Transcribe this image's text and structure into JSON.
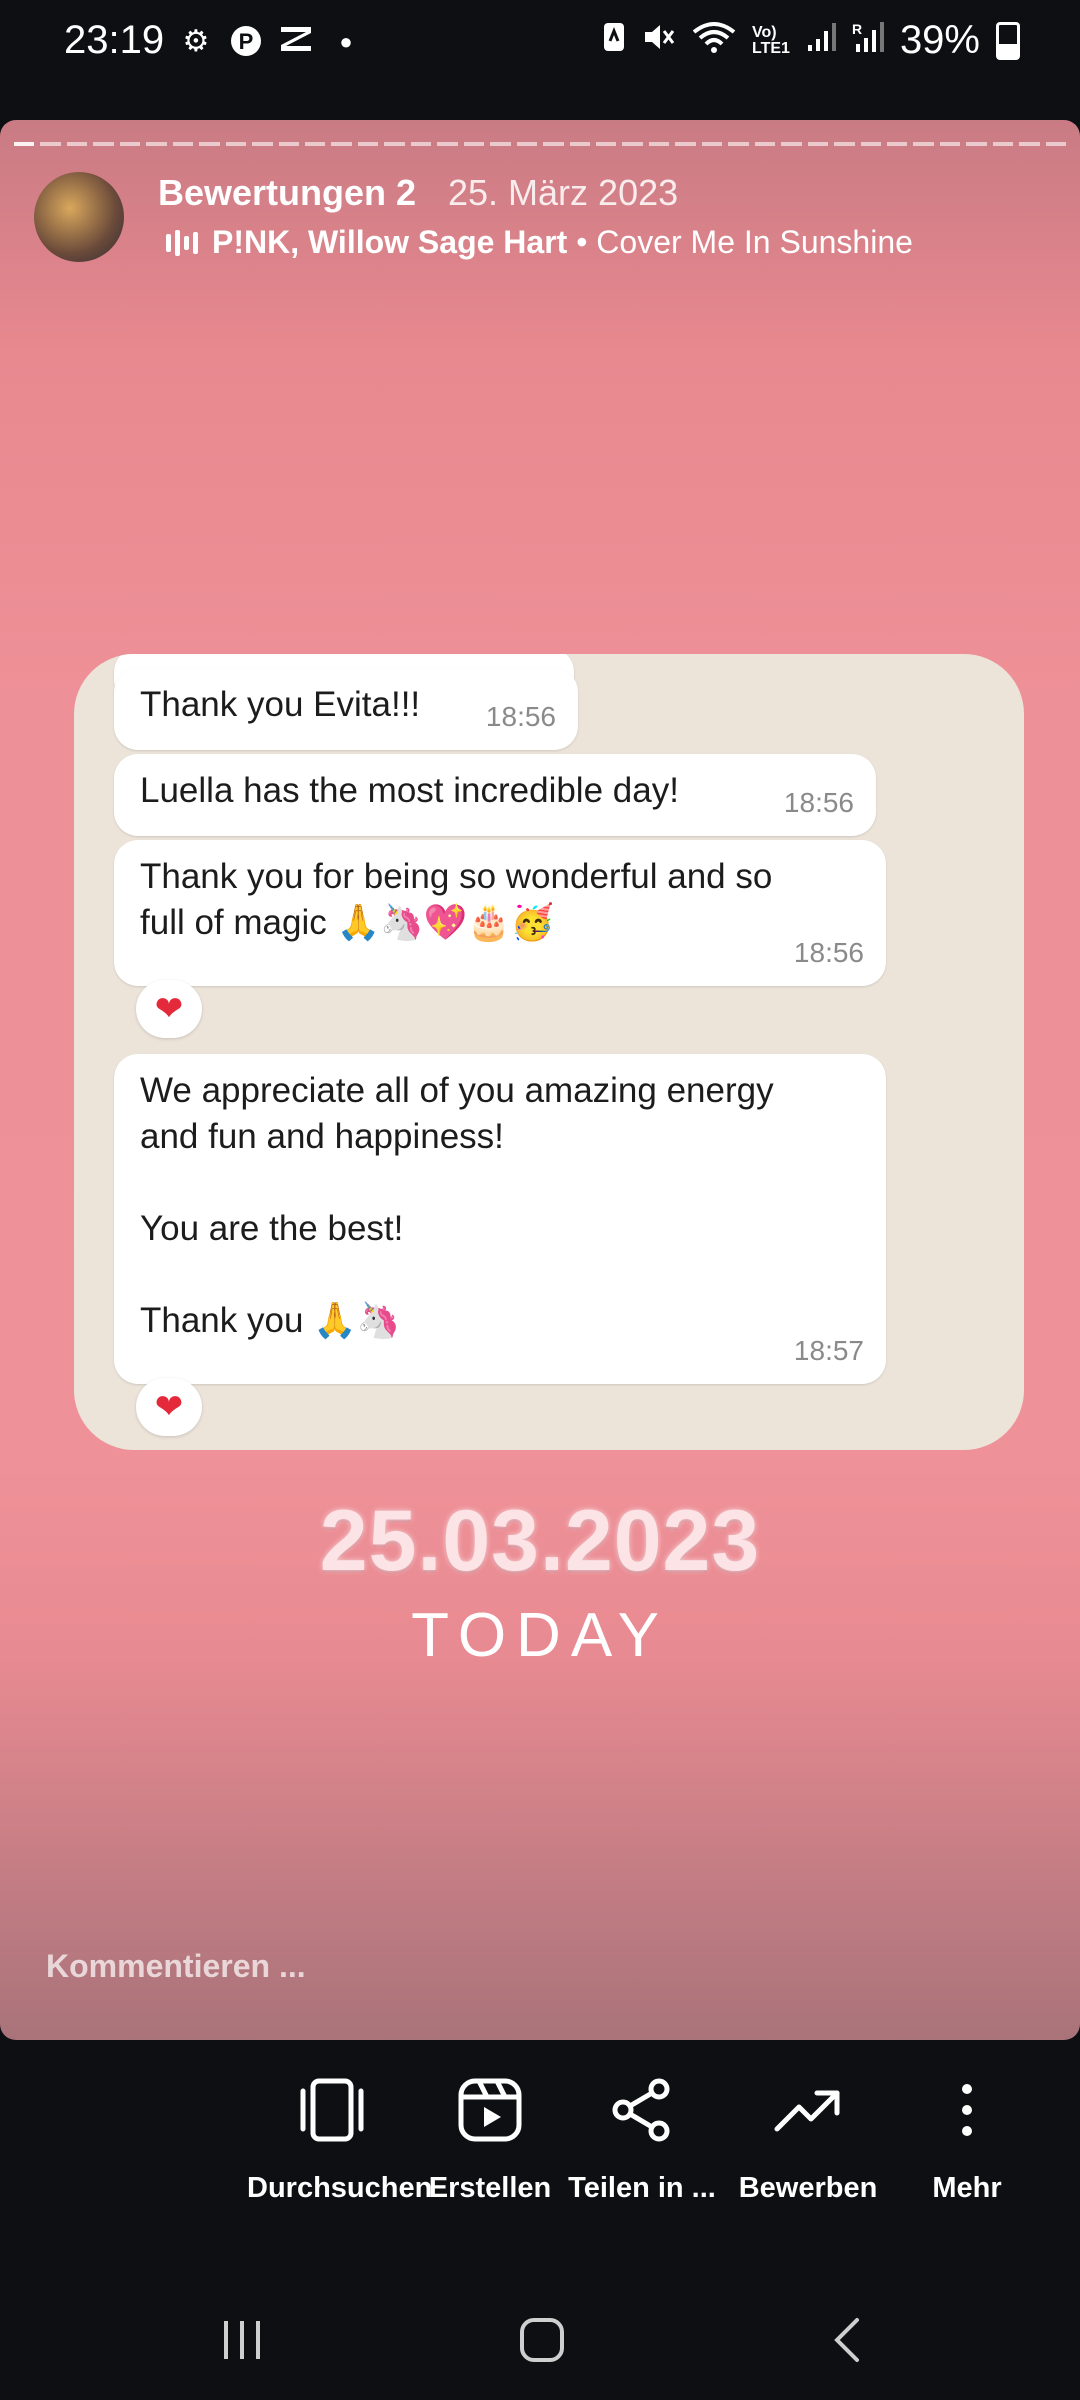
{
  "status_bar": {
    "time": "23:19",
    "left_icons": [
      "gear-icon",
      "pinterest-icon",
      "capcut-icon",
      "dot-icon"
    ],
    "right_icons": [
      "nfc-icon",
      "mute-icon",
      "wifi-icon",
      "volte-icon",
      "signal-icon",
      "signal-roaming-icon"
    ],
    "battery": "39%"
  },
  "story": {
    "account": "Bewertungen 2",
    "date": "25. März 2023",
    "music_artists": "P!NK, Willow Sage Hart",
    "music_song": "• Cover Me In Sunshine",
    "messages": [
      {
        "text": "Thank you Evita!!!",
        "time": "18:56"
      },
      {
        "text": "Luella has the most incredible day!",
        "time": "18:56"
      },
      {
        "text": "Thank you for being so wonderful and so\nfull of magic 🙏🦄💖🎂🥳",
        "time": "18:56"
      },
      {
        "text": "We appreciate all of you amazing energy\nand fun and happiness!\n\nYou are the best!\n\nThank you 🙏🦄",
        "time": "18:57"
      }
    ],
    "reaction": "❤",
    "big_date": "25.03.2023",
    "today": "TODAY",
    "comment_placeholder": "Kommentieren ..."
  },
  "actions": [
    {
      "label": "Durchsuchen",
      "icon": "browse-icon"
    },
    {
      "label": "Erstellen",
      "icon": "reels-create-icon"
    },
    {
      "label": "Teilen in ...",
      "icon": "share-icon"
    },
    {
      "label": "Bewerben",
      "icon": "trending-icon"
    },
    {
      "label": "Mehr",
      "icon": "more-vertical-icon"
    }
  ],
  "nav": [
    "recent-apps-icon",
    "home-icon",
    "back-icon"
  ]
}
